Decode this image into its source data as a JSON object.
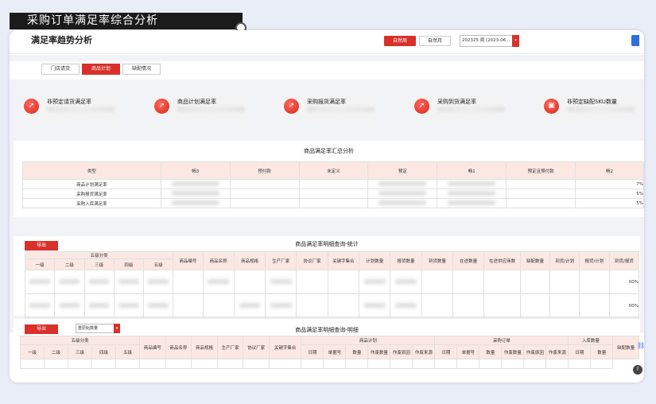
{
  "banner": {
    "title": "采购订单满足率综合分析"
  },
  "header": {
    "title": "满足率趋势分析",
    "btn_week": "自然周",
    "btn_month": "自然月",
    "date_value": "202325 周 (2023-06...",
    "dropdown_arrow": "▾"
  },
  "tabs": [
    {
      "label": "门店请货",
      "active": false
    },
    {
      "label": "商品计划",
      "active": true
    },
    {
      "label": "缺配情况",
      "active": false
    }
  ],
  "kpis": [
    {
      "label": "非预定请货满足率",
      "icon": "trend-up-icon",
      "glyph": "➚"
    },
    {
      "label": "商品计划满足率",
      "icon": "trend-up-icon",
      "glyph": "➚"
    },
    {
      "label": "采购报货满足率",
      "icon": "trend-up-icon",
      "glyph": "➚"
    },
    {
      "label": "采购到货满足率",
      "icon": "trend-up-icon",
      "glyph": "➚"
    },
    {
      "label": "非预定缺配SKU数量",
      "icon": "gift-icon",
      "glyph": "▣"
    }
  ],
  "summary": {
    "title": "商品满足率汇总分析",
    "headers": [
      "类型",
      "畅3",
      "预付款",
      "未定义",
      "预定",
      "畅1",
      "预定且预付款",
      "畅2"
    ],
    "rows": [
      {
        "type": "商品计划满足率",
        "last": "7%"
      },
      {
        "type": "采购报货满足率",
        "last": "5%"
      },
      {
        "type": "采购入库满足率",
        "last": "5%"
      }
    ]
  },
  "stats": {
    "title": "商品满足率明细查询-统计",
    "export_label": "导出",
    "group_header": "五级分类",
    "levels": [
      "一级",
      "二级",
      "三级",
      "四级",
      "五级"
    ],
    "headers": [
      "商品编号",
      "商品名称",
      "商品规格",
      "生产厂家",
      "协议厂家",
      "关键字集合",
      "计划数量",
      "报货数量",
      "到货数量",
      "在途数量",
      "在途供应商数",
      "缺配数量",
      "到货/计划",
      "报货/计划",
      "到货/报货"
    ],
    "row_values": [
      "00%",
      "00%"
    ]
  },
  "detail": {
    "title": "商品满足率明细查询-明细",
    "export_label": "导出",
    "select_value": "重原始数量",
    "group_five": "五级分类",
    "levels": [
      "一级",
      "二级",
      "三级",
      "四级",
      "五级"
    ],
    "info_headers": [
      "商品编号",
      "商品名称",
      "商品规格",
      "生产厂家",
      "协议厂家",
      "关键字集合"
    ],
    "group_plan": "商品计划",
    "plan_headers": [
      "日期",
      "单据号",
      "数量",
      "作废数量",
      "作废原因",
      "作废来源"
    ],
    "group_order": "采购订单",
    "order_headers": [
      "日期",
      "单据号",
      "数量",
      "作废数量",
      "作废原因",
      "作废来源"
    ],
    "group_in": "入库数量",
    "in_headers": [
      "日期",
      "数量"
    ],
    "last_header": "缺配数量"
  },
  "colors": {
    "accent": "#d9302a",
    "peach": "#fbe8e2"
  }
}
